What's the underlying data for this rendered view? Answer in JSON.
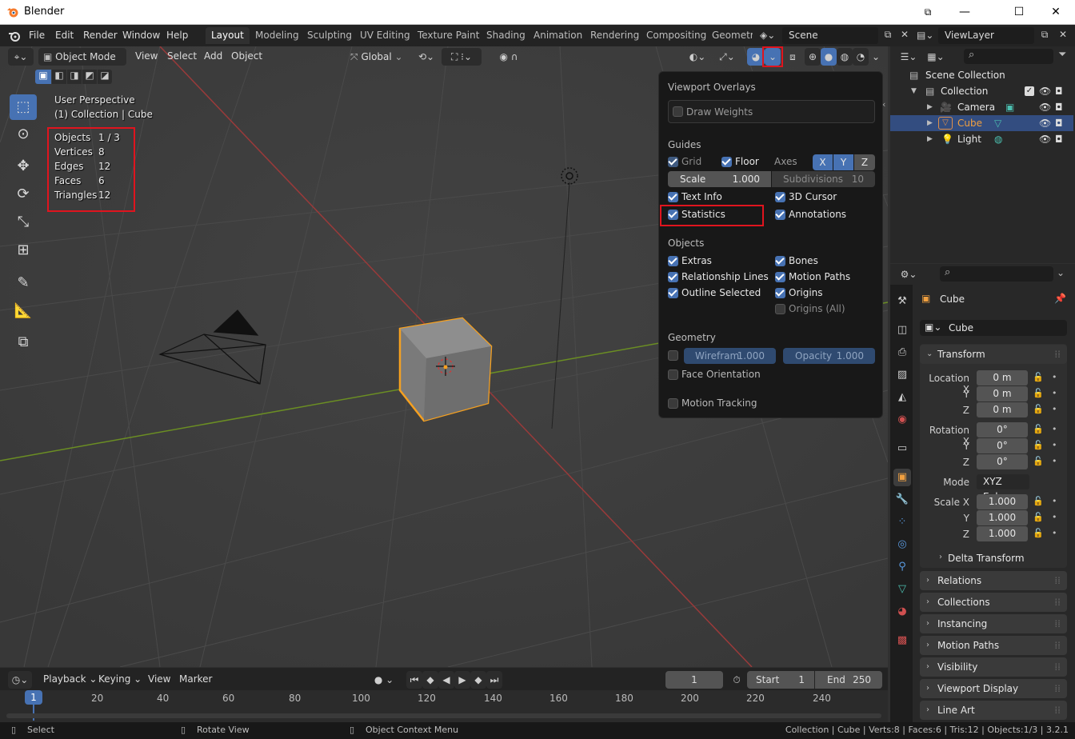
{
  "window": {
    "title": "Blender",
    "minimize": "—",
    "maximize": "☐",
    "close": "✕"
  },
  "menu": [
    "File",
    "Edit",
    "Render",
    "Window",
    "Help"
  ],
  "workspaces": [
    "Layout",
    "Modeling",
    "Sculpting",
    "UV Editing",
    "Texture Paint",
    "Shading",
    "Animation",
    "Rendering",
    "Compositing",
    "Geometry"
  ],
  "scene": {
    "name": "Scene",
    "view_layer": "ViewLayer"
  },
  "viewport_header": {
    "mode": "Object Mode",
    "menus": [
      "View",
      "Select",
      "Add",
      "Object"
    ],
    "transform_orientation": "Global"
  },
  "viewport_info": {
    "perspective": "User Perspective",
    "collection": "(1) Collection | Cube"
  },
  "stats": [
    {
      "label": "Objects",
      "value": "1 / 3"
    },
    {
      "label": "Vertices",
      "value": "8"
    },
    {
      "label": "Edges",
      "value": "12"
    },
    {
      "label": "Faces",
      "value": "6"
    },
    {
      "label": "Triangles",
      "value": "12"
    }
  ],
  "overlays": {
    "title": "Viewport Overlays",
    "draw_weights": "Draw Weights",
    "guides_title": "Guides",
    "grid": "Grid",
    "floor": "Floor",
    "axes": "Axes",
    "axis_x": "X",
    "axis_y": "Y",
    "axis_z": "Z",
    "scale_label": "Scale",
    "scale_value": "1.000",
    "subdiv_label": "Subdivisions",
    "subdiv_value": "10",
    "text_info": "Text Info",
    "cursor_3d": "3D Cursor",
    "statistics": "Statistics",
    "annotations": "Annotations",
    "objects_title": "Objects",
    "extras": "Extras",
    "bones": "Bones",
    "relationship_lines": "Relationship Lines",
    "motion_paths": "Motion Paths",
    "outline_selected": "Outline Selected",
    "origins": "Origins",
    "origins_all": "Origins (All)",
    "geometry_title": "Geometry",
    "wireframe_label": "Wirefram",
    "wireframe_value": "1.000",
    "opacity_label": "Opacity",
    "opacity_value": "1.000",
    "face_orientation": "Face Orientation",
    "motion_tracking": "Motion Tracking"
  },
  "outliner": {
    "scene_collection": "Scene Collection",
    "collection": "Collection",
    "items": [
      "Camera",
      "Cube",
      "Light"
    ]
  },
  "properties": {
    "object_name": "Cube",
    "data_name": "Cube",
    "transform": "Transform",
    "location_x_label": "Location X",
    "y_label": "Y",
    "z_label": "Z",
    "location": [
      "0 m",
      "0 m",
      "0 m"
    ],
    "rotation_x_label": "Rotation X",
    "rotation": [
      "0°",
      "0°",
      "0°"
    ],
    "mode_label": "Mode",
    "mode_value": "XYZ Eule",
    "scale_x_label": "Scale X",
    "scale": [
      "1.000",
      "1.000",
      "1.000"
    ],
    "delta_transform": "Delta Transform",
    "panels": [
      "Relations",
      "Collections",
      "Instancing",
      "Motion Paths",
      "Visibility",
      "Viewport Display",
      "Line Art"
    ]
  },
  "timeline": {
    "menus": [
      "Playback",
      "Keying",
      "View",
      "Marker"
    ],
    "current_frame": "1",
    "start_label": "Start",
    "start_value": "1",
    "end_label": "End",
    "end_value": "250",
    "ruler": [
      "1",
      "20",
      "40",
      "60",
      "80",
      "100",
      "120",
      "140",
      "160",
      "180",
      "200",
      "220",
      "240"
    ]
  },
  "statusbar": {
    "select": "Select",
    "rotate": "Rotate View",
    "context": "Object Context Menu",
    "info": "Collection | Cube | Verts:8 | Faces:6 | Tris:12 | Objects:1/3 | 3.2.1"
  }
}
